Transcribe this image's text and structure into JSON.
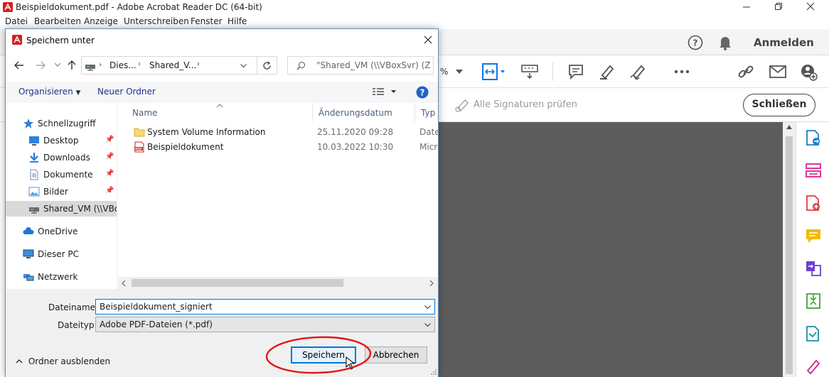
{
  "app": {
    "title": "Beispieldokument.pdf - Adobe Acrobat Reader DC (64-bit)",
    "menu": [
      "Datei",
      "Bearbeiten",
      "Anzeige",
      "Unterschreiben",
      "Fenster",
      "Hilfe"
    ],
    "anmelden": "Anmelden",
    "zoom_suffix": "%",
    "signatures_label": "Alle Signaturen prüfen",
    "close_label": "Schließen"
  },
  "dialog": {
    "title": "Speichern unter",
    "breadcrumb": [
      "Dies...",
      "Shared_V..."
    ],
    "search_placeholder": "\"Shared_VM (\\\\VBoxSvr) (Z:)...",
    "organize": "Organisieren",
    "new_folder": "Neuer Ordner",
    "nav": {
      "quick_access": "Schnellzugriff",
      "items": [
        {
          "label": "Desktop",
          "icon": "desktop-icon"
        },
        {
          "label": "Downloads",
          "icon": "downloads-icon"
        },
        {
          "label": "Dokumente",
          "icon": "documents-icon"
        },
        {
          "label": "Bilder",
          "icon": "pictures-icon"
        },
        {
          "label": "Shared_VM (\\\\VBox",
          "icon": "network-drive-icon"
        }
      ],
      "onedrive": "OneDrive",
      "this_pc": "Dieser PC",
      "network": "Netzwerk"
    },
    "columns": {
      "name": "Name",
      "modified": "Änderungsdatum",
      "type": "Typ"
    },
    "files": [
      {
        "name": "System Volume Information",
        "date": "25.11.2020 09:28",
        "type": "Datei",
        "icon": "folder-icon"
      },
      {
        "name": "Beispieldokument",
        "date": "10.03.2022 10:30",
        "type": "Micro",
        "icon": "pdf-file-icon"
      }
    ],
    "filename_label": "Dateiname:",
    "filename_value": "Beispieldokument_signiert",
    "filetype_label": "Dateityp:",
    "filetype_value": "Adobe PDF-Dateien (*.pdf)",
    "hide_folders": "Ordner ausblenden",
    "save": "Speichern",
    "cancel": "Abbrechen"
  },
  "colors": {
    "accent": "#0078d7",
    "annotation": "#e0161b",
    "acrobat_red": "#d41f1f"
  }
}
